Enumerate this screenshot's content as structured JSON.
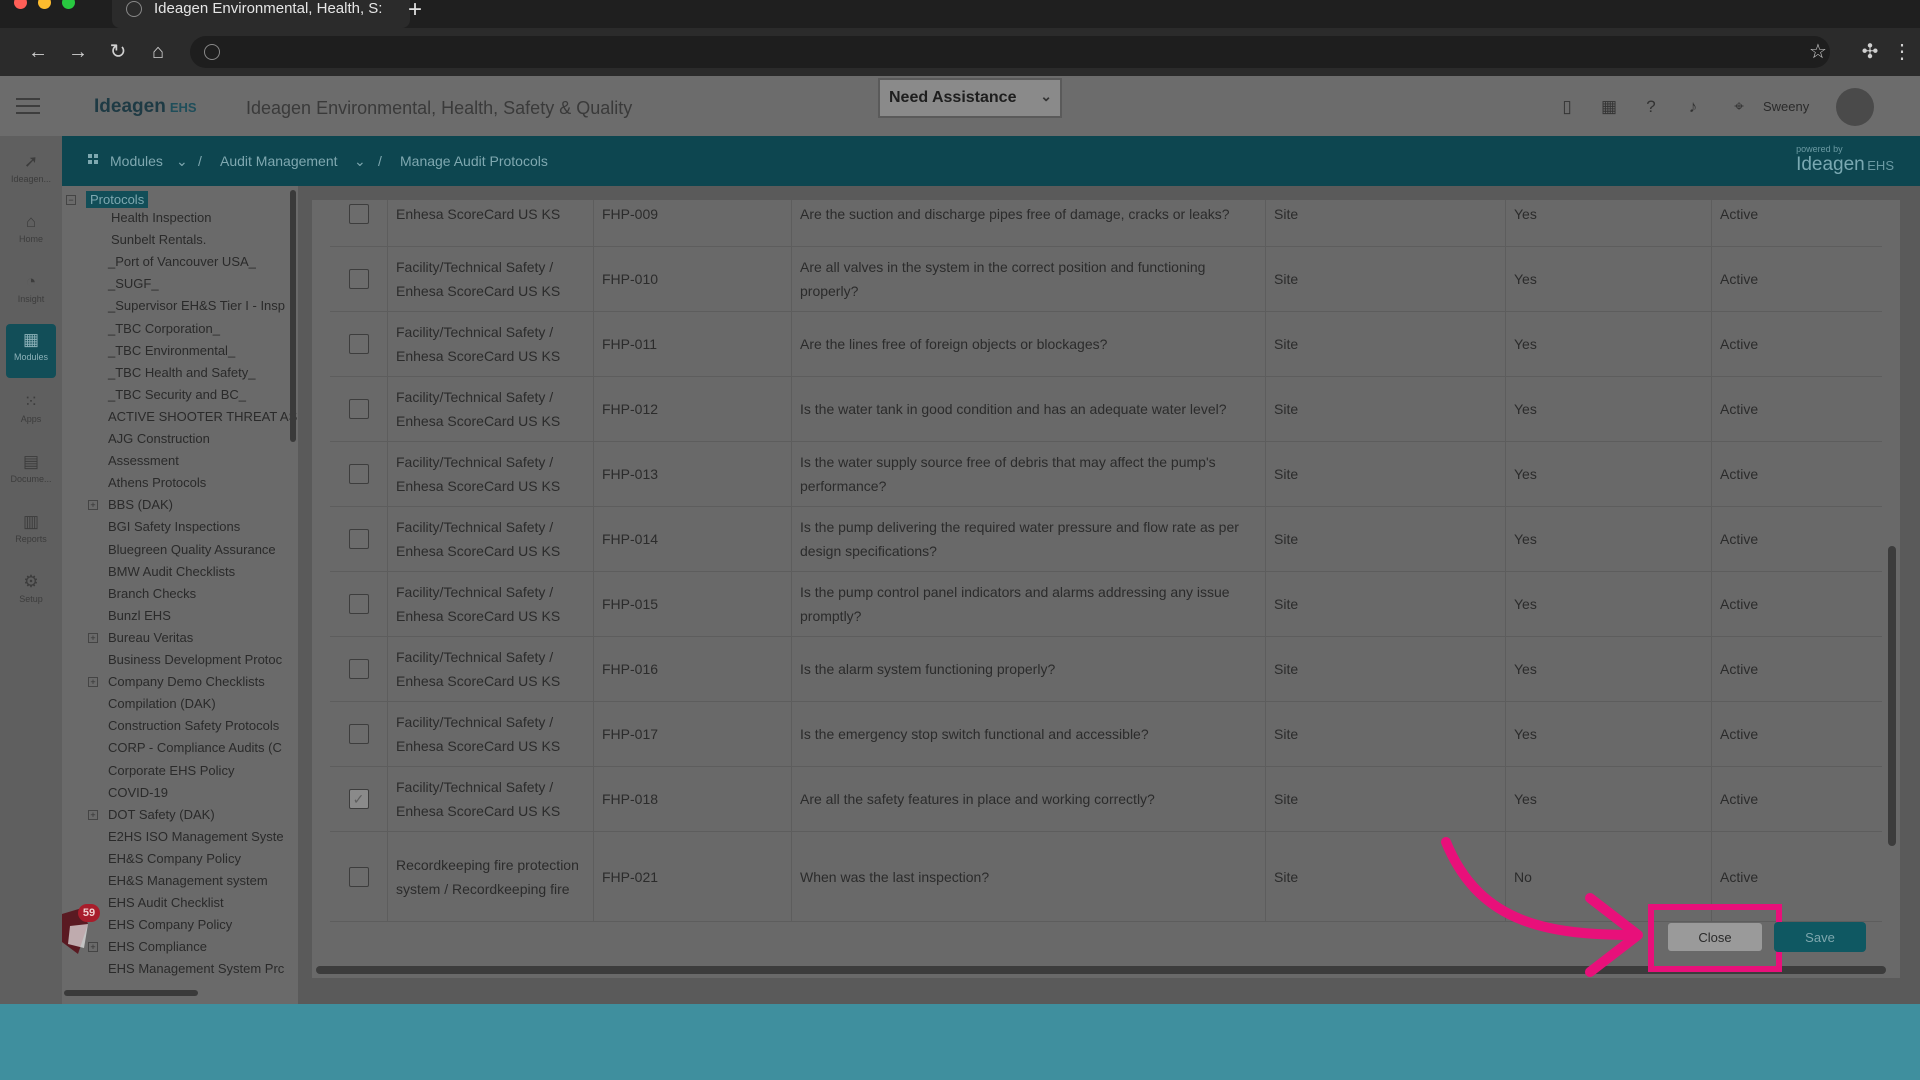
{
  "browser": {
    "tab_title": "Ideagen Environmental, Health, S:",
    "new_tab_symbol": "+"
  },
  "header": {
    "logo_text": "Ideagen",
    "logo_suffix": "EHS",
    "app_title": "Ideagen Environmental, Health, Safety & Quality",
    "assistance_select": "Need Assistance",
    "user_name": "Sweeny"
  },
  "breadcrumb": {
    "items": [
      "Modules",
      "Audit Management",
      "Manage Audit Protocols"
    ],
    "separator": "/",
    "powered_by": "powered by",
    "powered_logo": "Ideagen",
    "powered_suffix": "EHS"
  },
  "rail": {
    "items": [
      {
        "label": "Ideagen...",
        "icon": "ideagen-logo-icon"
      },
      {
        "label": "Home",
        "icon": "home-icon"
      },
      {
        "label": "Insight",
        "icon": "insight-icon"
      },
      {
        "label": "Modules",
        "icon": "modules-grid-icon"
      },
      {
        "label": "Apps",
        "icon": "apps-icon"
      },
      {
        "label": "Docume...",
        "icon": "document-icon"
      },
      {
        "label": "Reports",
        "icon": "reports-chart-icon"
      },
      {
        "label": "Setup",
        "icon": "gear-icon"
      }
    ]
  },
  "tree": {
    "root": "Protocols",
    "nodes": [
      "Health Inspection",
      "Sunbelt Rentals.",
      "_Port of Vancouver USA_",
      "_SUGF_",
      "_Supervisor EH&S Tier I - Insp",
      "_TBC Corporation_",
      "_TBC Environmental_",
      "_TBC Health and Safety_",
      "_TBC Security and BC_",
      "ACTIVE SHOOTER THREAT AS",
      "AJG Construction",
      "Assessment",
      "Athens Protocols",
      "BBS (DAK)",
      "BGI Safety Inspections",
      "Bluegreen Quality Assurance",
      "BMW Audit Checklists",
      "Branch Checks",
      "Bunzl EHS",
      "Bureau Veritas",
      "Business Development Protoc",
      "Company Demo Checklists",
      "Compilation (DAK)",
      "Construction Safety Protocols",
      "CORP - Compliance Audits (C",
      "Corporate EHS Policy",
      "COVID-19",
      "DOT Safety (DAK)",
      "E2HS ISO Management Syste",
      "EH&S Company Policy",
      "EH&S Management system",
      "EHS Audit Checklist",
      "EHS Company Policy",
      "EHS Compliance",
      "EHS Management System Prc"
    ],
    "expandable_symbol": "+",
    "collapse_symbol": "−"
  },
  "table": {
    "rows": [
      {
        "checked": false,
        "category": "Enhesa ScoreCard US KS",
        "code": "FHP-009",
        "question": "Are the suction and discharge pipes free of damage, cracks or leaks?",
        "level": "Site",
        "required": "Yes",
        "status": "Active"
      },
      {
        "checked": false,
        "category": "Facility/Technical Safety / Enhesa ScoreCard US KS",
        "code": "FHP-010",
        "question": "Are all valves in the system in the correct position and functioning properly?",
        "level": "Site",
        "required": "Yes",
        "status": "Active"
      },
      {
        "checked": false,
        "category": "Facility/Technical Safety / Enhesa ScoreCard US KS",
        "code": "FHP-011",
        "question": "Are the lines free of foreign objects or blockages?",
        "level": "Site",
        "required": "Yes",
        "status": "Active"
      },
      {
        "checked": false,
        "category": "Facility/Technical Safety / Enhesa ScoreCard US KS",
        "code": "FHP-012",
        "question": "Is the water tank in good condition and has an adequate water level?",
        "level": "Site",
        "required": "Yes",
        "status": "Active"
      },
      {
        "checked": false,
        "category": "Facility/Technical Safety / Enhesa ScoreCard US KS",
        "code": "FHP-013",
        "question": "Is the water supply source free of debris that may affect the pump's performance?",
        "level": "Site",
        "required": "Yes",
        "status": "Active"
      },
      {
        "checked": false,
        "category": "Facility/Technical Safety / Enhesa ScoreCard US KS",
        "code": "FHP-014",
        "question": "Is the pump delivering the required water pressure and flow rate as per design specifications?",
        "level": "Site",
        "required": "Yes",
        "status": "Active"
      },
      {
        "checked": false,
        "category": "Facility/Technical Safety / Enhesa ScoreCard US KS",
        "code": "FHP-015",
        "question": "Is the pump control panel indicators and alarms addressing any issue promptly?",
        "level": "Site",
        "required": "Yes",
        "status": "Active"
      },
      {
        "checked": false,
        "category": "Facility/Technical Safety / Enhesa ScoreCard US KS",
        "code": "FHP-016",
        "question": "Is the alarm system functioning properly?",
        "level": "Site",
        "required": "Yes",
        "status": "Active"
      },
      {
        "checked": false,
        "category": "Facility/Technical Safety / Enhesa ScoreCard US KS",
        "code": "FHP-017",
        "question": "Is the emergency stop switch functional and accessible?",
        "level": "Site",
        "required": "Yes",
        "status": "Active"
      },
      {
        "checked": true,
        "category": "Facility/Technical Safety / Enhesa ScoreCard US KS",
        "code": "FHP-018",
        "question": "Are all the safety features in place and working correctly?",
        "level": "Site",
        "required": "Yes",
        "status": "Active"
      },
      {
        "checked": false,
        "category": "Recordkeeping fire protection system / Recordkeeping fire",
        "code": "FHP-021",
        "question": "When was the last inspection?",
        "level": "Site",
        "required": "No",
        "status": "Active"
      }
    ]
  },
  "actions": {
    "close_label": "Close",
    "save_label": "Save"
  },
  "notifications": {
    "count": "59"
  },
  "colors": {
    "highlight": "#e8107a",
    "brand_teal": "#0d4650",
    "accent_save": "#0f5862"
  }
}
